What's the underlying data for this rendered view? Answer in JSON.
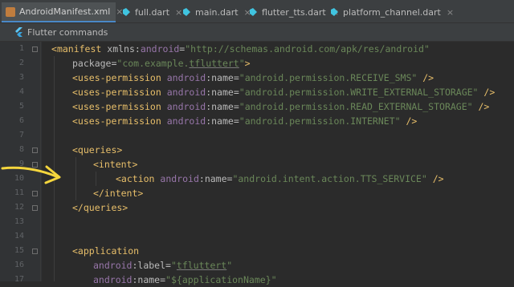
{
  "tabs": [
    {
      "label": "AndroidManifest.xml",
      "icon": "xml-file-icon",
      "active": true
    },
    {
      "label": "full.dart",
      "icon": "dart-file-icon"
    },
    {
      "label": "main.dart",
      "icon": "dart-file-icon"
    },
    {
      "label": "flutter_tts.dart",
      "icon": "dart-file-icon"
    },
    {
      "label": "platform_channel.dart",
      "icon": "dart-file-icon"
    }
  ],
  "close_glyph": "×",
  "subbar": {
    "label": "Flutter commands",
    "icon": "flutter-icon"
  },
  "line_numbers": [
    "1",
    "2",
    "3",
    "4",
    "5",
    "6",
    "7",
    "8",
    "9",
    "10",
    "11",
    "12",
    "13",
    "14",
    "15",
    "16",
    "17"
  ],
  "code": {
    "l1": {
      "open": "<",
      "tag": "manifest",
      "sp": " ",
      "ns": "xmlns",
      "colon": ":",
      "attr": "android",
      "eq": "=",
      "val": "\"http://schemas.android.com/apk/res/android\""
    },
    "l2": {
      "attr": "package",
      "eq": "=",
      "val_a": "\"com.example.",
      "val_b": "tfluttert",
      "val_c": "\"",
      "close": ">"
    },
    "perm_tag": "<uses-permission",
    "ns_android": "android",
    "colon": ":",
    "name_attr": "name",
    "eq": "=",
    "self_close": " />",
    "l3_val": "\"android.permission.RECEIVE_SMS\"",
    "l4_val": "\"android.permission.WRITE_EXTERNAL_STORAGE\"",
    "l5_val": "\"android.permission.READ_EXTERNAL_STORAGE\"",
    "l6_val": "\"android.permission.INTERNET\"",
    "l8": "<queries>",
    "l9": "<intent>",
    "l10_tag": "<action",
    "l10_val": "\"android.intent.action.TTS_SERVICE\"",
    "l11": "</intent>",
    "l12": "</queries>",
    "l15": "<application",
    "l16_attr": "label",
    "l16_val_q": "\"",
    "l16_val": "tfluttert",
    "l17_attr": "name",
    "l17_val": "\"${applicationName}\""
  },
  "annotation": {
    "icon": "yellow-arrow-icon",
    "color": "#f5d63d"
  },
  "colors": {
    "tag": "#e8bf6a",
    "namespace": "#9876aa",
    "value": "#6a8759",
    "background": "#2b2b2b"
  }
}
